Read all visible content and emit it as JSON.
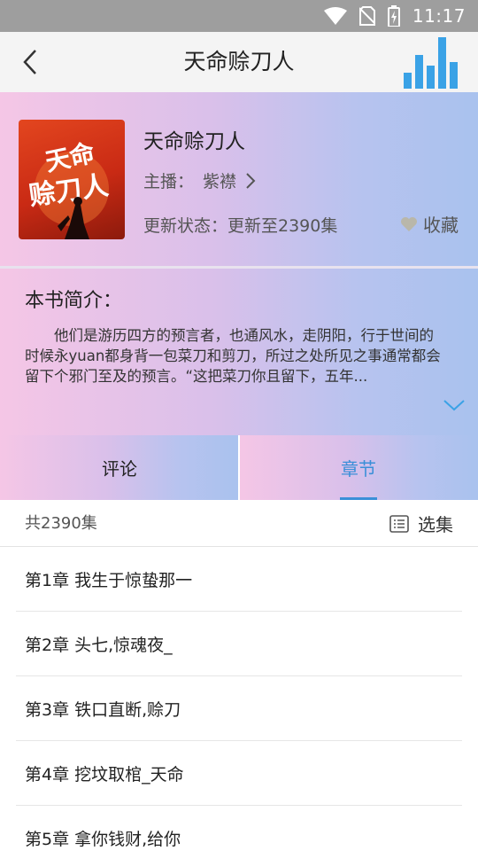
{
  "status_bar": {
    "time": "11:17",
    "icons": [
      "wifi-icon",
      "no-sim-icon",
      "battery-charging-icon"
    ]
  },
  "app_bar": {
    "title": "天命赊刀人",
    "back_icon": "chevron-left-icon",
    "player_icon": "equalizer-icon"
  },
  "book": {
    "cover": {
      "title_art": "天命赊刀人"
    },
    "title": "天命赊刀人",
    "anchor_label": "主播：",
    "anchor_name": "紫襟",
    "update_status": "更新状态：更新至2390集",
    "favorite_label": "收藏"
  },
  "intro": {
    "title": "本书简介：",
    "text": "他们是游历四方的预言者，也通风水，走阴阳，行于世间的时候永yuan都身背一包菜刀和剪刀，所过之处所见之事通常都会留下个邪门至及的预言。“这把菜刀你且留下，五年..."
  },
  "tabs": [
    {
      "label": "评论",
      "active": false
    },
    {
      "label": "章节",
      "active": true
    }
  ],
  "list_header": {
    "count": "共2390集",
    "select_label": "选集"
  },
  "chapters": [
    "第1章 我生于惊蛰那一",
    "第2章 头七,惊魂夜_",
    "第3章 铁口直断,赊刀",
    "第4章 挖坟取棺_天命",
    "第5章 拿你钱财,给你"
  ],
  "colors": {
    "accent": "#3a8fd8",
    "gradient_start": "#f5c6e6",
    "gradient_end": "#a9c2ee",
    "status_bar": "#9e9e9e"
  }
}
